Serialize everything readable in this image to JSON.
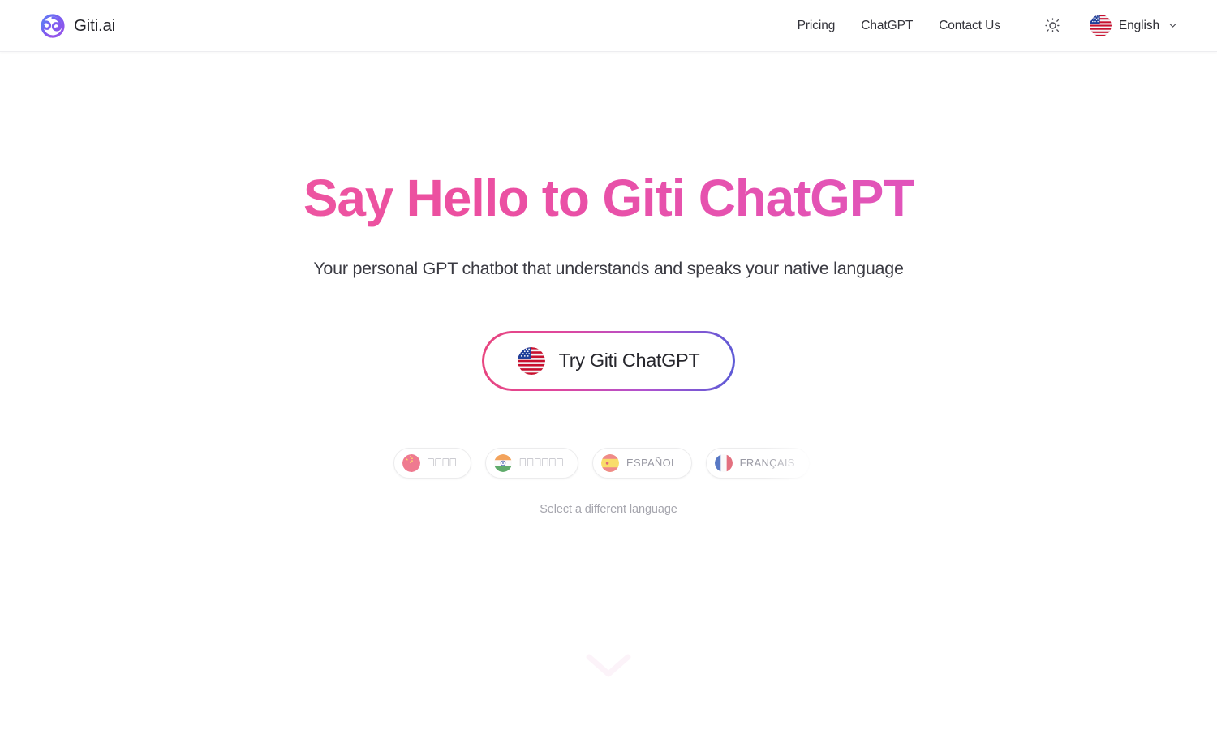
{
  "header": {
    "brand": {
      "name": "Giti.ai",
      "logo_icon": "spiral-logo-icon"
    },
    "nav": [
      {
        "label": "Pricing",
        "name": "pricing"
      },
      {
        "label": "ChatGPT",
        "name": "chatgpt"
      },
      {
        "label": "Contact Us",
        "name": "contact-us"
      }
    ],
    "theme_toggle": {
      "icon": "sun-icon",
      "mode": "light"
    },
    "language": {
      "label": "English",
      "flag": "flag-us",
      "chevron_icon": "chevron-down-icon"
    }
  },
  "hero": {
    "title": "Say Hello to Giti ChatGPT",
    "subtitle": "Your personal GPT chatbot that understands and speaks your native language",
    "title_gradient_from": "#ef5fa3",
    "title_gradient_to": "#d556d8"
  },
  "cta": {
    "label": "Try Giti ChatGPT",
    "flag": "flag-us",
    "border_gradient_from": "#e8457e",
    "border_gradient_to": "#5b5bd6"
  },
  "languages": {
    "hint": "Select a different language",
    "pills": [
      {
        "label": "⎕⎕⎕⎕",
        "flag": "flag-cn",
        "name": "chinese",
        "tofu": true
      },
      {
        "label": "⎕⎕⎕⎕⎕⎕",
        "flag": "flag-in",
        "name": "hindi",
        "tofu": true
      },
      {
        "label": "ESPAÑOL",
        "flag": "flag-es",
        "name": "spanish",
        "tofu": false
      },
      {
        "label": "FRANÇAIS",
        "flag": "flag-fr",
        "name": "french",
        "tofu": false
      },
      {
        "label": "",
        "flag": "flag-de",
        "name": "german",
        "tofu": false
      }
    ]
  },
  "scroll_cue": {
    "icon": "chevron-down-icon"
  }
}
